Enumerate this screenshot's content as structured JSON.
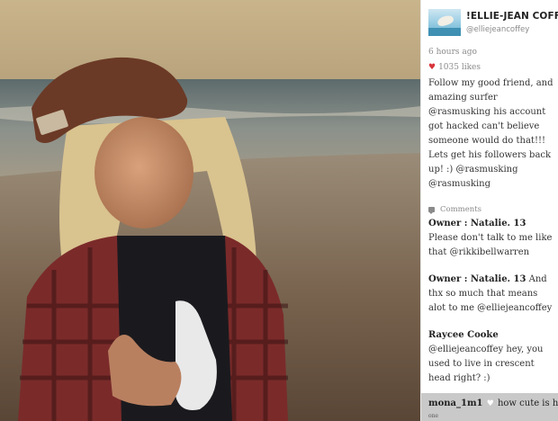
{
  "post": {
    "display_name": "!ELLIE-JEAN COFFEY",
    "username": "@elliejeancoffey",
    "time": "6 hours ago",
    "likes": "1035 likes",
    "caption": "Follow my good friend, and amazing surfer @rasmusking his account got hacked can't believe someone would do that!!! Lets get his followers back up! :) @rasmusking @rasmusking",
    "comments_label": "Comments"
  },
  "comments": [
    {
      "author": "Owner : Natalie. 13",
      "text": "Please don't talk to me like that @rikkibellwarren"
    },
    {
      "author": "Owner : Natalie. 13",
      "text": "And thx so much that means alot to me @elliejeancoffey"
    },
    {
      "author": "Raycee Cooke",
      "text": "@elliejeancoffey hey, you used to live in crescent head right? :)"
    }
  ],
  "bottom_comment": {
    "author": "mona_1m1",
    "text": "how cute is he",
    "sub": "one"
  },
  "colors": {
    "like_heart": "#d8333a",
    "bottom_bar": "#c9c9c9"
  },
  "icons": {
    "likes": "heart-icon",
    "comments": "comment-icon"
  }
}
